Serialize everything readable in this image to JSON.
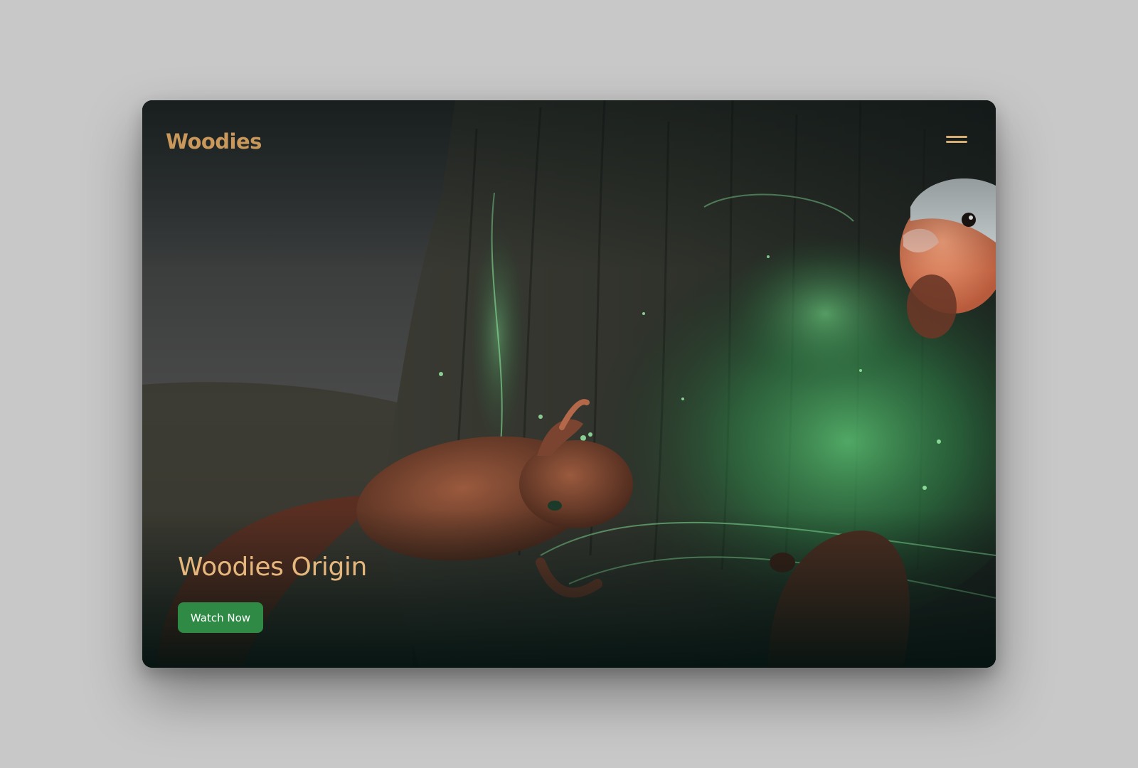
{
  "header": {
    "logo_text": "Woodies",
    "menu_icon": "hamburger-menu-icon"
  },
  "hero": {
    "title": "Woodies Origin",
    "cta_label": "Watch Now",
    "background_scene": "animated-forest-scene-image"
  },
  "colors": {
    "page_background": "#c8c8c8",
    "brand_gold": "#c9985a",
    "title_gold": "#e6b77c",
    "cta_green": "#2f8a45",
    "logo_leaf_green": "#4db85a"
  }
}
